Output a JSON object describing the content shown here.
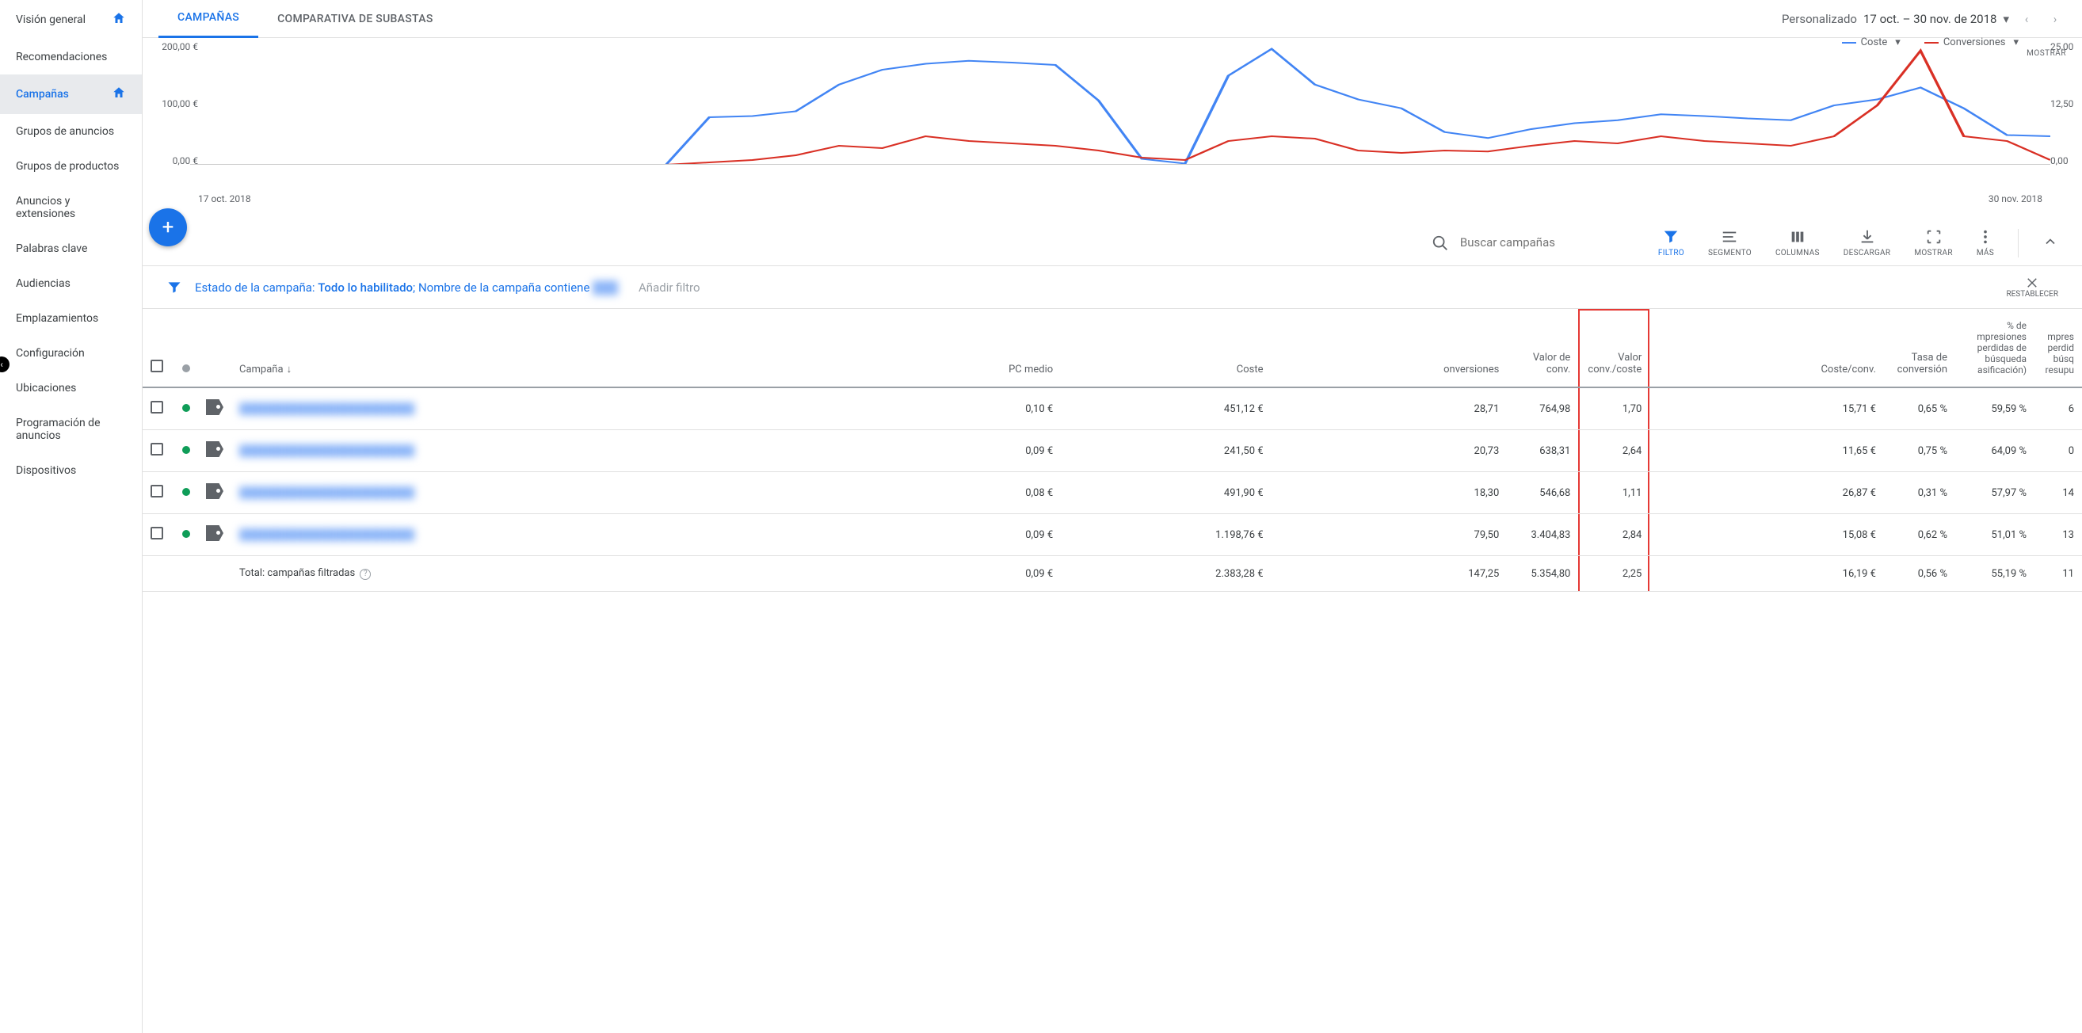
{
  "sidebar": {
    "items": [
      {
        "label": "Visión general",
        "home": true
      },
      {
        "label": "Recomendaciones"
      },
      {
        "label": "Campañas",
        "active": true,
        "home": true
      },
      {
        "label": "Grupos de anuncios"
      },
      {
        "label": "Grupos de productos"
      },
      {
        "label": "Anuncios y extensiones"
      },
      {
        "label": "Palabras clave"
      },
      {
        "label": "Audiencias"
      },
      {
        "label": "Emplazamientos"
      },
      {
        "label": "Configuración"
      },
      {
        "label": "Ubicaciones"
      },
      {
        "label": "Programación de anuncios"
      },
      {
        "label": "Dispositivos"
      }
    ]
  },
  "tabs": {
    "items": [
      {
        "label": "CAMPAÑAS",
        "active": true
      },
      {
        "label": "COMPARATIVA DE SUBASTAS"
      }
    ]
  },
  "date": {
    "label": "Personalizado",
    "range": "17 oct. – 30 nov. de 2018"
  },
  "legend": {
    "a": "Coste",
    "b": "Conversiones",
    "mostrar": "MOSTRAR"
  },
  "chart_data": {
    "type": "line",
    "x_start": "17 oct. 2018",
    "x_end": "30 nov. 2018",
    "y_left": {
      "label": "€",
      "ticks": [
        "0,00 €",
        "100,00 €",
        "200,00 €"
      ],
      "max": 200
    },
    "y_right": {
      "label": "",
      "ticks": [
        "0,00",
        "12,50",
        "25,00"
      ],
      "max": 25
    },
    "series": [
      {
        "name": "Coste",
        "color": "#4285f4",
        "axis": "left",
        "values": [
          0,
          0,
          0,
          0,
          0,
          0,
          0,
          0,
          0,
          0,
          0,
          0,
          80,
          82,
          90,
          135,
          160,
          170,
          175,
          172,
          168,
          108,
          10,
          2,
          150,
          195,
          135,
          110,
          95,
          55,
          45,
          60,
          70,
          75,
          85,
          82,
          78,
          75,
          100,
          110,
          130,
          95,
          50,
          48
        ]
      },
      {
        "name": "Conversiones",
        "color": "#d93025",
        "axis": "right",
        "values": [
          0,
          0,
          0,
          0,
          0,
          0,
          0,
          0,
          0,
          0,
          0,
          0,
          0.5,
          1,
          2,
          4,
          3.5,
          6,
          5,
          4.5,
          4,
          3,
          1.5,
          1,
          5,
          6,
          5.5,
          3,
          2.5,
          3,
          2.8,
          4,
          5,
          4.5,
          6,
          5,
          4.5,
          4,
          6,
          12.5,
          24,
          6,
          5,
          1
        ]
      }
    ]
  },
  "toolbar": {
    "search_placeholder": "Buscar campañas",
    "filtro": "FILTRO",
    "segmento": "SEGMENTO",
    "columnas": "COLUMNAS",
    "descargar": "DESCARGAR",
    "mostrar": "MOSTRAR",
    "mas": "MÁS"
  },
  "filter": {
    "prefix": "Estado de la campaña: ",
    "state": "Todo lo habilitado",
    "mid": "; Nombre de la campaña contiene ",
    "value": "███",
    "add": "Añadir filtro",
    "reset": "RESTABLECER"
  },
  "table": {
    "headers": {
      "campaign": "Campaña",
      "cpc": "PC medio",
      "coste": "Coste",
      "conv": "onversiones",
      "valor_conv": "Valor de conv.",
      "valor_coste": "Valor conv./coste",
      "coste_conv": "Coste/conv.",
      "tasa": "Tasa de conversión",
      "impr_perdidas": "% de mpresiones perdidas de búsqueda asificación)",
      "impr2": "mpres perdid búsq resupu"
    },
    "rows": [
      {
        "name": "████████████████████████",
        "cpc": "0,10 €",
        "coste": "451,12 €",
        "conv": "28,71",
        "valor_conv": "764,98",
        "valor_coste": "1,70",
        "coste_conv": "15,71 €",
        "tasa": "0,65 %",
        "impr": "59,59 %",
        "impr2": "6"
      },
      {
        "name": "████████████████████████",
        "cpc": "0,09 €",
        "coste": "241,50 €",
        "conv": "20,73",
        "valor_conv": "638,31",
        "valor_coste": "2,64",
        "coste_conv": "11,65 €",
        "tasa": "0,75 %",
        "impr": "64,09 %",
        "impr2": "0"
      },
      {
        "name": "████████████████████████",
        "cpc": "0,08 €",
        "coste": "491,90 €",
        "conv": "18,30",
        "valor_conv": "546,68",
        "valor_coste": "1,11",
        "coste_conv": "26,87 €",
        "tasa": "0,31 %",
        "impr": "57,97 %",
        "impr2": "14"
      },
      {
        "name": "████████████████████████",
        "cpc": "0,09 €",
        "coste": "1.198,76 €",
        "conv": "79,50",
        "valor_conv": "3.404,83",
        "valor_coste": "2,84",
        "coste_conv": "15,08 €",
        "tasa": "0,62 %",
        "impr": "51,01 %",
        "impr2": "13"
      }
    ],
    "total": {
      "label": "Total: campañas filtradas",
      "cpc": "0,09 €",
      "coste": "2.383,28 €",
      "conv": "147,25",
      "valor_conv": "5.354,80",
      "valor_coste": "2,25",
      "coste_conv": "16,19 €",
      "tasa": "0,56 %",
      "impr": "55,19 %",
      "impr2": "11"
    }
  }
}
